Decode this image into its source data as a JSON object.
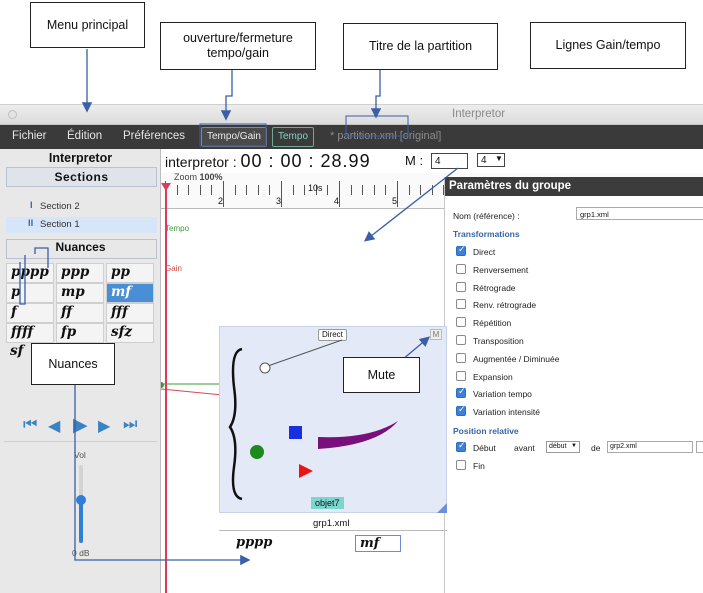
{
  "annotations": {
    "menu": "Menu principal",
    "tempo_gain_toggle": "ouverture/fermeture tempo/gain",
    "score_title": "Titre de la partition",
    "lines": "Lignes Gain/tempo",
    "nuances": "Nuances",
    "mute": "Mute"
  },
  "window": {
    "title": "Interpretor"
  },
  "menubar": {
    "items": [
      "Fichier",
      "Édition",
      "Préférences"
    ],
    "toggle_label": "Tempo/Gain",
    "tempo_label": "Tempo",
    "score_title": "* partition.xml [original]"
  },
  "left": {
    "app_name": "Interpretor",
    "sections_label": "Sections",
    "sections": [
      {
        "label": "Section 2",
        "marker": "I"
      },
      {
        "label": "Section 1",
        "marker": "II"
      }
    ],
    "nuances_label": "Nuances",
    "dynamics": [
      "pppp",
      "ppp",
      "pp",
      "p",
      "mp",
      "mf",
      "f",
      "ff",
      "fff",
      "ffff",
      "fp",
      "sfz",
      "sf"
    ],
    "selected_dynamic": "mf",
    "vol_label": "Vol",
    "vol_value": "0 dB",
    "vol_level": 0.55
  },
  "timeline": {
    "prefix": "interpretor :",
    "time": "00 : 00 : 28.99",
    "measure_label": "M :",
    "measure_value": "4",
    "beats_value": "4",
    "zoom_label": "Zoom",
    "zoom_value": "100%",
    "ruler_time": "10s",
    "ruler_marks": [
      "2",
      "3",
      "4",
      "5"
    ],
    "tempo_label": "Tempo",
    "gain_label": "Gain"
  },
  "group": {
    "direct_label": "Direct",
    "mute_label": "M",
    "object_name": "objet7",
    "file_name": "grp1.xml",
    "start_dynamic": "pppp",
    "end_dynamic": "mf"
  },
  "params": {
    "header": "Paramètres du groupe",
    "name_label": "Nom (référence) :",
    "name_value": "grp1.xml",
    "transformations_label": "Transformations",
    "transformations": [
      {
        "label": "Direct",
        "checked": true
      },
      {
        "label": "Renversement",
        "checked": false
      },
      {
        "label": "Rétrograde",
        "checked": false
      },
      {
        "label": "Renv. rétrograde",
        "checked": false
      },
      {
        "label": "Répétition",
        "checked": false
      },
      {
        "label": "Transposition",
        "checked": false
      },
      {
        "label": "Augmentée / Diminuée",
        "checked": false
      },
      {
        "label": "Expansion",
        "checked": false
      },
      {
        "label": "Variation tempo",
        "checked": true
      },
      {
        "label": "Variation intensité",
        "checked": true
      }
    ],
    "relative_label": "Position relative",
    "start_label": "Début",
    "start_checked": true,
    "before_label": "avant",
    "anchor_value": "début",
    "of_label": "de",
    "ref_value": "grp2.xml",
    "end_label": "Fin",
    "end_checked": false
  }
}
